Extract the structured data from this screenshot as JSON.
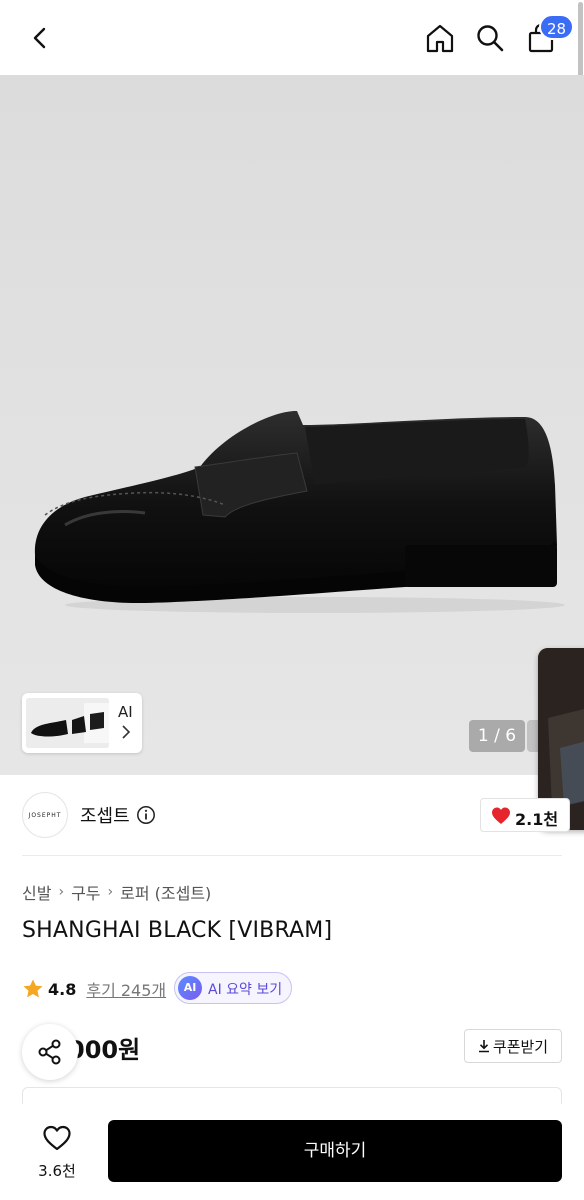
{
  "header": {
    "cart_count": "28",
    "icons": [
      "chevron-left-icon",
      "home-icon",
      "search-icon",
      "shopping-bag-icon"
    ]
  },
  "gallery": {
    "thumb_label": "AI",
    "counter": "1 / 6"
  },
  "brand": {
    "logo_text": "JOSEPHT",
    "name": "조셉트",
    "like_count": "2.1천"
  },
  "breadcrumb": [
    "신발",
    "구두",
    "로퍼 (조셉트)"
  ],
  "product": {
    "title": "SHANGHAI BLACK [VIBRAM]",
    "rating": "4.8",
    "review_label": "후기 245개",
    "ai_badge": "AI",
    "ai_summary_label": "AI 요약 보기",
    "price": "000원",
    "coupon_label": "쿠폰받기"
  },
  "bottom_bar": {
    "wish_count": "3.6천",
    "buy_label": "구매하기"
  },
  "colors": {
    "accent": "#3b6cf6",
    "heart": "#e5242c",
    "star": "#f5a623",
    "buy_button": "#000000"
  }
}
